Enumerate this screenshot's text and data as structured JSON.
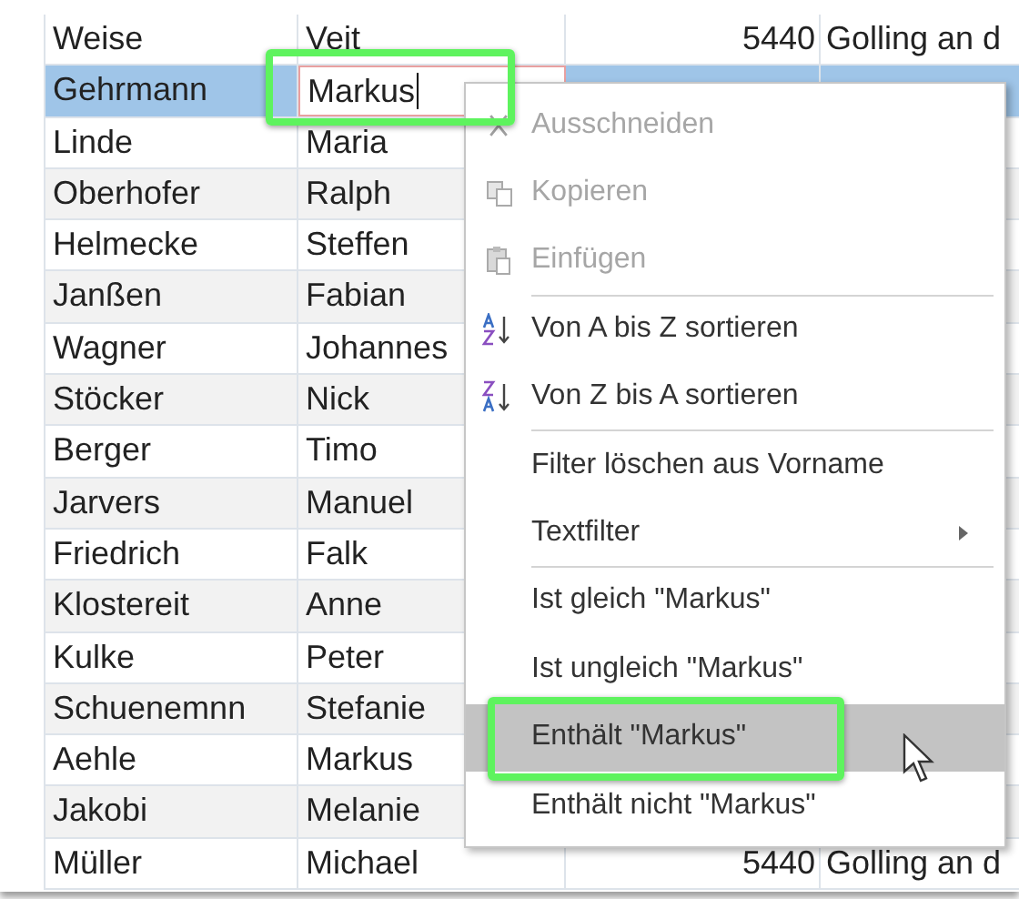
{
  "rows": [
    {
      "last": "Weise",
      "first": "Veit",
      "postal": "5440",
      "city": "Golling an d",
      "selected": false
    },
    {
      "last": "Gehrmann",
      "first": "Markus",
      "selected": true,
      "editing": true
    },
    {
      "last": "Linde",
      "first": "Maria",
      "selected": false
    },
    {
      "last": "Oberhofer",
      "first": "Ralph",
      "selected": false
    },
    {
      "last": "Helmecke",
      "first": "Steffen",
      "selected": false
    },
    {
      "last": "Janßen",
      "first": "Fabian",
      "selected": false
    },
    {
      "last": "Wagner",
      "first": "Johannes",
      "selected": false
    },
    {
      "last": "Stöcker",
      "first": "Nick",
      "selected": false
    },
    {
      "last": "Berger",
      "first": "Timo",
      "selected": false
    },
    {
      "last": "Jarvers",
      "first": "Manuel",
      "selected": false
    },
    {
      "last": "Friedrich",
      "first": "Falk",
      "selected": false
    },
    {
      "last": "Klostereit",
      "first": "Anne",
      "selected": false
    },
    {
      "last": "Kulke",
      "first": "Peter",
      "selected": false
    },
    {
      "last": "Schuenemnn",
      "first": "Stefanie",
      "selected": false
    },
    {
      "last": "Aehle",
      "first": "Markus",
      "selected": false
    },
    {
      "last": "Jakobi",
      "first": "Melanie",
      "selected": false
    },
    {
      "last": "Müller",
      "first": "Michael",
      "postal": "5440",
      "city": "Golling an d",
      "selected": false
    }
  ],
  "context_menu": {
    "items": [
      {
        "label": "Ausschneiden",
        "kind": "cut",
        "disabled": true,
        "selected": false
      },
      {
        "label": "Kopieren",
        "kind": "copy",
        "disabled": true,
        "selected": false
      },
      {
        "label": "Einfügen",
        "kind": "paste",
        "disabled": true,
        "selected": false
      },
      {
        "label": "Von A bis Z sortieren",
        "kind": "ascending",
        "disabled": false,
        "selected": false,
        "separator_before": true
      },
      {
        "label": "Von Z bis A sortieren",
        "kind": "descending",
        "disabled": false,
        "selected": false
      },
      {
        "label": "Filter löschen aus Vorname",
        "disabled": false,
        "selected": false,
        "separator_before": true
      },
      {
        "label": "Textfilter",
        "disabled": false,
        "selected": false,
        "submenu": true
      },
      {
        "label": "Ist gleich \"Markus\"",
        "disabled": false,
        "selected": false,
        "separator_before": true
      },
      {
        "label": "Ist ungleich \"Markus\"",
        "disabled": false,
        "selected": false
      },
      {
        "label": "Enthält \"Markus\"",
        "disabled": false,
        "selected": true,
        "highlighted_frame": true
      },
      {
        "label": "Enthält nicht \"Markus\"",
        "disabled": false,
        "selected": false
      }
    ]
  }
}
